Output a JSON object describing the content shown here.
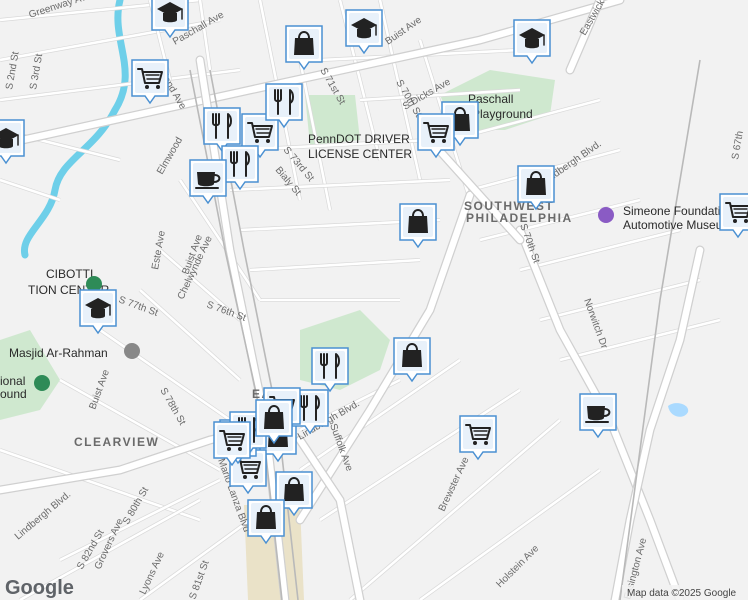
{
  "map": {
    "footer": {
      "logo": "Google",
      "attribution": "Map data ©2025 Google"
    },
    "colors": {
      "land": "#f2f2f2",
      "road": "#ffffff",
      "road_edge": "#d9d9d9",
      "park": "#cfe8cf",
      "water": "#aadaff",
      "creek": "#6ecfe9",
      "airport_zone": "#eae2c8",
      "marker_fill": "#e8f1fa",
      "marker_border": "#4a90d2",
      "icon_dark": "#222222",
      "poi_green": "#2e8b57",
      "poi_purple": "#8a5bc4",
      "poi_gray": "#888888"
    },
    "area_labels": [
      {
        "text": "SOUTHWEST",
        "key": "sw1"
      },
      {
        "text": "PHILADELPHIA",
        "key": "sw2"
      },
      {
        "text": "CLEARVIEW",
        "key": "clearview"
      },
      {
        "text": "EASTWICK",
        "key": "eastwick"
      }
    ],
    "place_labels": [
      {
        "text": "Paschall",
        "key": "paschall1"
      },
      {
        "text": "Playground",
        "key": "paschall2"
      },
      {
        "text": "PennDOT DRIVER",
        "key": "penndot1"
      },
      {
        "text": "LICENSE CENTER",
        "key": "penndot2"
      },
      {
        "text": "CIBOTTI",
        "key": "cibotti1"
      },
      {
        "text": "TION CENTER",
        "key": "cibotti2"
      },
      {
        "text": "Masjid Ar-Rahman",
        "key": "masjid"
      },
      {
        "text": "ional",
        "key": "ional1"
      },
      {
        "text": "ound",
        "key": "ional2"
      },
      {
        "text": "Simeone Foundation",
        "key": "sim1"
      },
      {
        "text": "Automotive Museum",
        "key": "sim2"
      }
    ],
    "street_labels": [
      "Greenway Ave",
      "Paschall Ave",
      "Island Ave",
      "S 3rd St",
      "S 2nd St",
      "Buist Ave",
      "S 71st St",
      "S Dicks Ave",
      "S 70th St",
      "S 73rd St",
      "Bialy St",
      "Elmwood",
      "Lindbergh Blvd.",
      "S 70th St",
      "Eastwick Ave",
      "Este Ave",
      "Buist Ave",
      "Chelwynde Ave",
      "S 76th St",
      "S 77th St",
      "Norwitch Dr",
      "Buist Ave",
      "S 78th St",
      "Lindbergh Blvd.",
      "Suffolk Ave",
      "Mario Lanza Blvd",
      "Lindbergh Blvd.",
      "S 80th St",
      "Grovers Ave",
      "S 82nd St",
      "Lyons Ave",
      "S 81st St",
      "Brewster Ave",
      "Holstein Ave",
      "Essington Ave",
      "S 67th"
    ],
    "markers": [
      {
        "icon": "graduation-cap",
        "key": "school"
      },
      {
        "icon": "graduation-cap",
        "key": "school"
      },
      {
        "icon": "graduation-cap",
        "key": "school"
      },
      {
        "icon": "graduation-cap",
        "key": "school"
      },
      {
        "icon": "shopping-bag",
        "key": "bag"
      },
      {
        "icon": "shopping-bag",
        "key": "bag"
      },
      {
        "icon": "shopping-bag",
        "key": "bag"
      },
      {
        "icon": "shopping-bag",
        "key": "bag"
      },
      {
        "icon": "shopping-bag",
        "key": "bag"
      },
      {
        "icon": "shopping-bag",
        "key": "bag"
      },
      {
        "icon": "shopping-bag",
        "key": "bag"
      },
      {
        "icon": "shopping-bag",
        "key": "bag"
      },
      {
        "icon": "shopping-cart",
        "key": "cart"
      },
      {
        "icon": "shopping-cart",
        "key": "cart"
      },
      {
        "icon": "shopping-cart",
        "key": "cart"
      },
      {
        "icon": "shopping-cart",
        "key": "cart"
      },
      {
        "icon": "shopping-cart",
        "key": "cart"
      },
      {
        "icon": "shopping-cart",
        "key": "cart"
      },
      {
        "icon": "fork-knife",
        "key": "restaurant"
      },
      {
        "icon": "fork-knife",
        "key": "restaurant"
      },
      {
        "icon": "fork-knife",
        "key": "restaurant"
      },
      {
        "icon": "fork-knife",
        "key": "restaurant"
      },
      {
        "icon": "fork-knife",
        "key": "restaurant"
      },
      {
        "icon": "fork-knife",
        "key": "restaurant"
      },
      {
        "icon": "coffee-cup",
        "key": "cafe"
      },
      {
        "icon": "coffee-cup",
        "key": "cafe"
      },
      {
        "icon": "graduation-cap",
        "key": "school"
      },
      {
        "icon": "shopping-cart",
        "key": "cart"
      },
      {
        "icon": "fork-knife",
        "key": "restaurant"
      },
      {
        "icon": "shopping-bag",
        "key": "bag"
      },
      {
        "icon": "shopping-cart",
        "key": "cart"
      }
    ]
  }
}
